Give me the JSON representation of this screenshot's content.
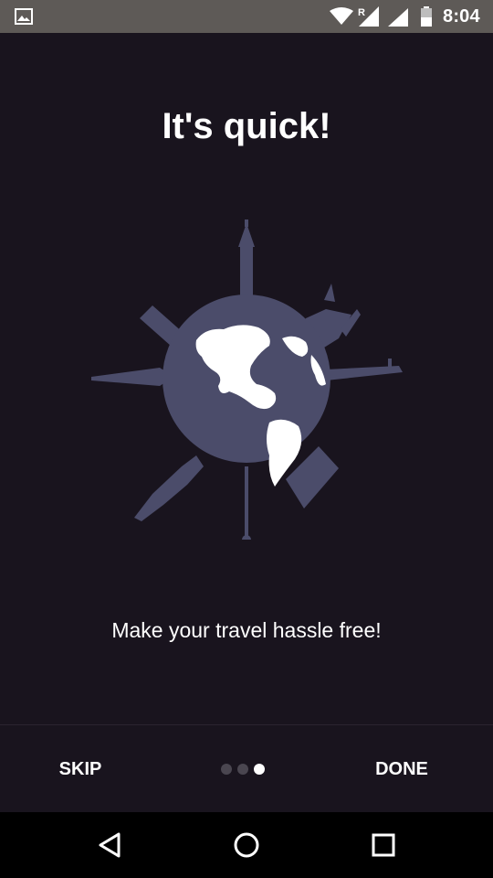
{
  "status_bar": {
    "time": "8:04",
    "icons": [
      "gallery-icon",
      "wifi-icon",
      "signal-roaming-icon",
      "signal-icon",
      "battery-icon"
    ],
    "roaming_label": "R"
  },
  "onboarding": {
    "title": "It's quick!",
    "subtitle": "Make your travel hassle free!",
    "illustration": "globe-with-landmarks-illustration",
    "page_count": 3,
    "active_page": 3
  },
  "bottom_bar": {
    "skip_label": "SKIP",
    "done_label": "DONE"
  },
  "nav_bar": {
    "icons": [
      "back-icon",
      "home-icon",
      "recents-icon"
    ]
  },
  "colors": {
    "background": "#19141e",
    "status_bar": "#5e5a57",
    "globe": "#4b4c6a",
    "text": "#ffffff",
    "dot_active": "#ffffff",
    "dot_inactive": "#4a4650"
  }
}
